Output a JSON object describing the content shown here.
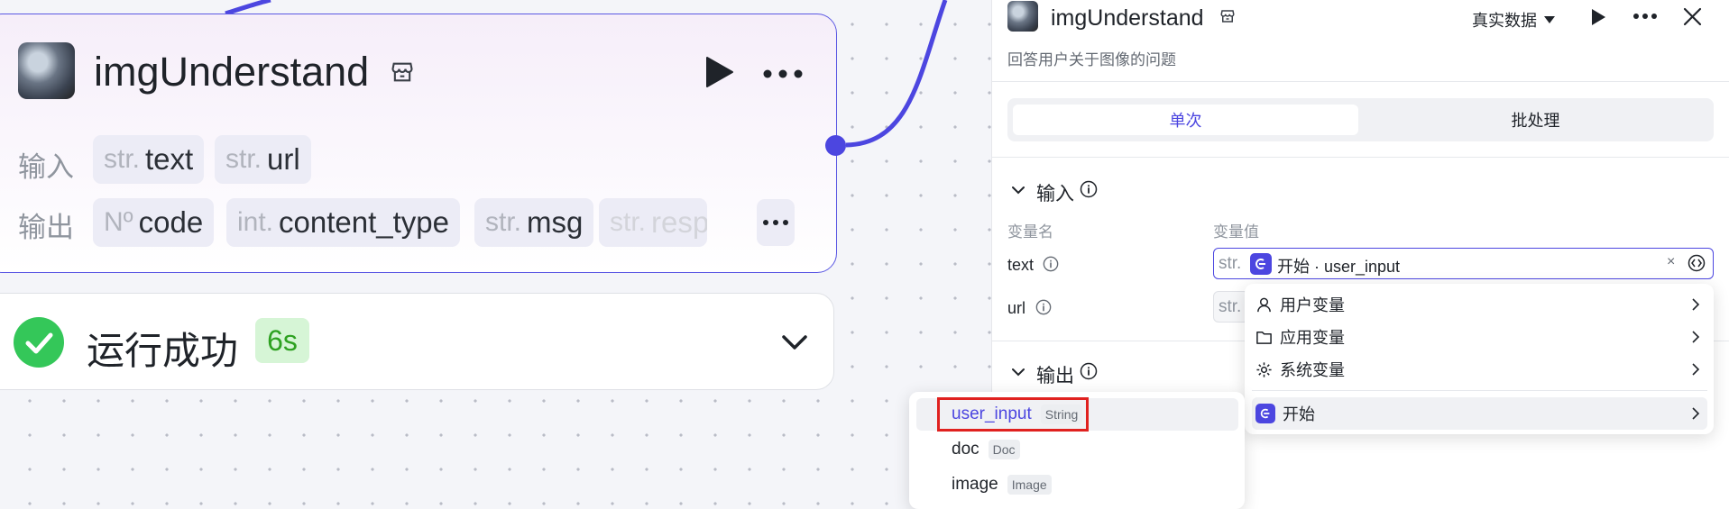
{
  "node": {
    "title": "imgUnderstand",
    "input_label": "输入",
    "output_label": "输出",
    "inputs": [
      {
        "type": "str.",
        "name": "text"
      },
      {
        "type": "str.",
        "name": "url"
      }
    ],
    "outputs": [
      {
        "type": "Nº",
        "name": "code"
      },
      {
        "type": "int.",
        "name": "content_type"
      },
      {
        "type": "str.",
        "name": "msg"
      },
      {
        "type": "str.",
        "name": "resp"
      }
    ]
  },
  "status": {
    "text": "运行成功",
    "duration": "6s"
  },
  "panel": {
    "title": "imgUnderstand",
    "data_source": "真实数据",
    "description": "回答用户关于图像的问题",
    "tabs": [
      "单次",
      "批处理"
    ],
    "input_section": "输入",
    "output_section": "输出",
    "col_name": "变量名",
    "col_value": "变量值",
    "vars": [
      {
        "name": "text",
        "prefix": "str.",
        "value": "开始 · user_input"
      },
      {
        "name": "url",
        "prefix": "str."
      }
    ],
    "clear_icon": "×"
  },
  "var_menu": {
    "items": [
      {
        "icon": "user-icon",
        "label": "用户变量"
      },
      {
        "icon": "folder-icon",
        "label": "应用变量"
      },
      {
        "icon": "gear-icon",
        "label": "系统变量"
      },
      {
        "icon": "start-icon",
        "label": "开始"
      }
    ]
  },
  "start_submenu": {
    "items": [
      {
        "name": "user_input",
        "type": "String"
      },
      {
        "name": "doc",
        "type": "Doc"
      },
      {
        "name": "image",
        "type": "Image"
      }
    ]
  },
  "colors": {
    "accent": "#4c46e0",
    "success": "#2ea121",
    "highlight_box": "#e0211f"
  }
}
